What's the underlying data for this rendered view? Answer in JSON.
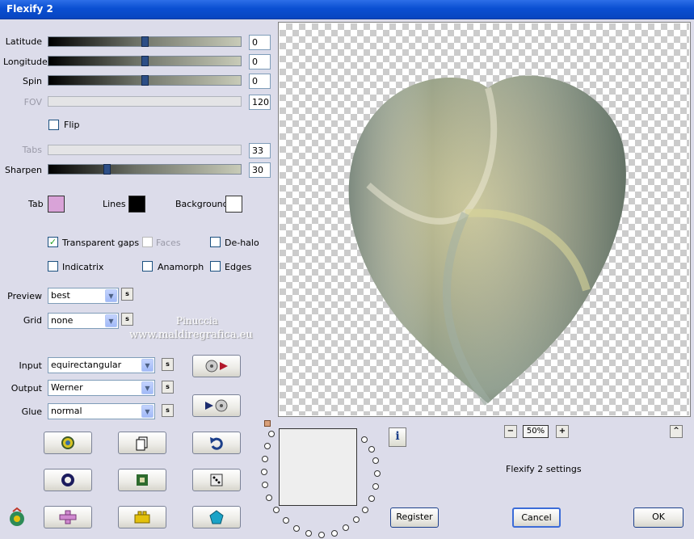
{
  "window": {
    "title": "Flexify 2"
  },
  "sliders": [
    {
      "label": "Latitude",
      "value": "0",
      "level": 0.5,
      "disabled": false
    },
    {
      "label": "Longitude",
      "value": "0",
      "level": 0.5,
      "disabled": false
    },
    {
      "label": "Spin",
      "value": "0",
      "level": 0.5,
      "disabled": false
    },
    {
      "label": "FOV",
      "value": "120",
      "level": 0.0,
      "disabled": true
    },
    {
      "label": "Tabs",
      "value": "33",
      "level": 0.0,
      "disabled": true
    },
    {
      "label": "Sharpen",
      "value": "30",
      "level": 0.3,
      "disabled": false
    }
  ],
  "flip": {
    "label": "Flip",
    "checked": false
  },
  "colors": {
    "tab": {
      "label": "Tab",
      "color": "#d9a3d8"
    },
    "lines": {
      "label": "Lines",
      "color": "#000000"
    },
    "background": {
      "label": "Background",
      "color": "#ffffff"
    }
  },
  "options": {
    "transparent_gaps": {
      "label": "Transparent gaps",
      "checked": true
    },
    "faces": {
      "label": "Faces",
      "checked": false,
      "disabled": true
    },
    "de_halo": {
      "label": "De-halo",
      "checked": false
    },
    "indicatrix": {
      "label": "Indicatrix",
      "checked": false
    },
    "anamorph": {
      "label": "Anamorph",
      "checked": false
    },
    "edges": {
      "label": "Edges",
      "checked": false
    }
  },
  "preview_select": {
    "label": "Preview",
    "value": "best"
  },
  "grid_select": {
    "label": "Grid",
    "value": "none"
  },
  "input_select": {
    "label": "Input",
    "value": "equirectangular"
  },
  "output_select": {
    "label": "Output",
    "value": "Werner"
  },
  "glue_select": {
    "label": "Glue",
    "value": "normal"
  },
  "sbtn": "s",
  "watermark": {
    "line1": "Pinuccia",
    "line2": "www.maldiregrafica.eu"
  },
  "zoom": {
    "value": "50%",
    "minus": "−",
    "plus": "+"
  },
  "settings_label": "Flexify 2 settings",
  "buttons": {
    "register": "Register",
    "cancel": "Cancel",
    "ok": "OK",
    "info": "i",
    "up": "^"
  },
  "icons": [
    "gear-icon",
    "copy-icon",
    "undo-icon",
    "ring-icon",
    "square-icon",
    "dice-icon",
    "cross-icon",
    "brick-icon",
    "pentagon-icon"
  ]
}
